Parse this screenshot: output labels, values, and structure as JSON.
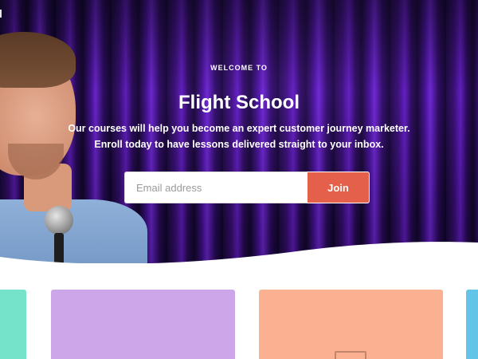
{
  "hero": {
    "eyebrow": "WELCOME TO",
    "title": "Flight School",
    "subtitle_line1": "Our courses will help you become an expert customer journey marketer.",
    "subtitle_line2": "Enroll today to have lessons delivered straight to your inbox."
  },
  "signup": {
    "email_placeholder": "Email address",
    "join_label": "Join"
  },
  "colors": {
    "join_button": "#e4604a",
    "card_teal": "#74e3c9",
    "card_lavender": "#cca6e8",
    "card_peach": "#fbb191",
    "card_blue": "#62c4e6"
  }
}
